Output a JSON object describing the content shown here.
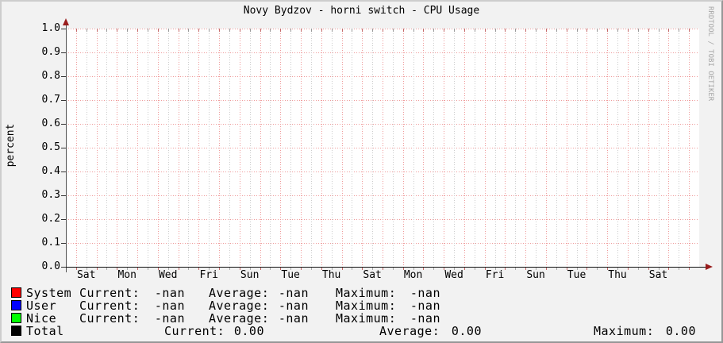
{
  "title": "Novy Bydzov - horni switch - CPU Usage",
  "watermark": "RRDTOOL / TOBI OETIKER",
  "y_axis": {
    "label": "percent",
    "ticks": [
      "1.0",
      "0.9",
      "0.8",
      "0.7",
      "0.6",
      "0.5",
      "0.4",
      "0.3",
      "0.2",
      "0.1",
      "0.0"
    ]
  },
  "x_axis": {
    "ticks": [
      "Sat",
      "Mon",
      "Wed",
      "Fri",
      "Sun",
      "Tue",
      "Thu",
      "Sat",
      "Mon",
      "Wed",
      "Fri",
      "Sun",
      "Tue",
      "Thu",
      "Sat"
    ]
  },
  "legend": {
    "col_labels": {
      "current": "Current:",
      "average": "Average:",
      "maximum": "Maximum:"
    },
    "rows": [
      {
        "name": "System",
        "color": "#ff0000",
        "current": "-nan",
        "average": "-nan",
        "maximum": "-nan",
        "layout": "stats"
      },
      {
        "name": "User",
        "color": "#0000ff",
        "current": "-nan",
        "average": "-nan",
        "maximum": "-nan",
        "layout": "stats"
      },
      {
        "name": "Nice",
        "color": "#00ff00",
        "current": "-nan",
        "average": "-nan",
        "maximum": "-nan",
        "layout": "stats"
      },
      {
        "name": "Total",
        "color": "#000000",
        "current": "0.00",
        "average": "0.00",
        "maximum": "0.00",
        "layout": "total"
      }
    ]
  },
  "chart_data": {
    "type": "line",
    "title": "Novy Bydzov - horni switch - CPU Usage",
    "xlabel": "",
    "ylabel": "percent",
    "ylim": [
      0.0,
      1.0
    ],
    "y_tick_step": 0.1,
    "x_tick_labels": [
      "Sat",
      "Mon",
      "Wed",
      "Fri",
      "Sun",
      "Tue",
      "Thu",
      "Sat",
      "Mon",
      "Wed",
      "Fri",
      "Sun",
      "Tue",
      "Thu",
      "Sat"
    ],
    "x_span": "approx. 30 days, day gridlines with half-day minor gridlines",
    "grid": true,
    "legend_position": "bottom",
    "note": "plot area is empty - no series lines are drawn",
    "series": [
      {
        "name": "System",
        "color": "#ff0000",
        "values": [],
        "current": "-nan",
        "average": "-nan",
        "maximum": "-nan"
      },
      {
        "name": "User",
        "color": "#0000ff",
        "values": [],
        "current": "-nan",
        "average": "-nan",
        "maximum": "-nan"
      },
      {
        "name": "Nice",
        "color": "#00ff00",
        "values": [],
        "current": "-nan",
        "average": "-nan",
        "maximum": "-nan"
      },
      {
        "name": "Total",
        "color": "#000000",
        "values": [],
        "current": "0.00",
        "average": "0.00",
        "maximum": "0.00"
      }
    ]
  },
  "colors": {
    "background": "#f2f2f2",
    "canvas": "#ffffff",
    "grid_major": "#ef9a9a",
    "grid_minor": "#cccccc",
    "axis": "#222222",
    "arrow": "#991c1c",
    "watermark_text": "#a6a6a6"
  }
}
